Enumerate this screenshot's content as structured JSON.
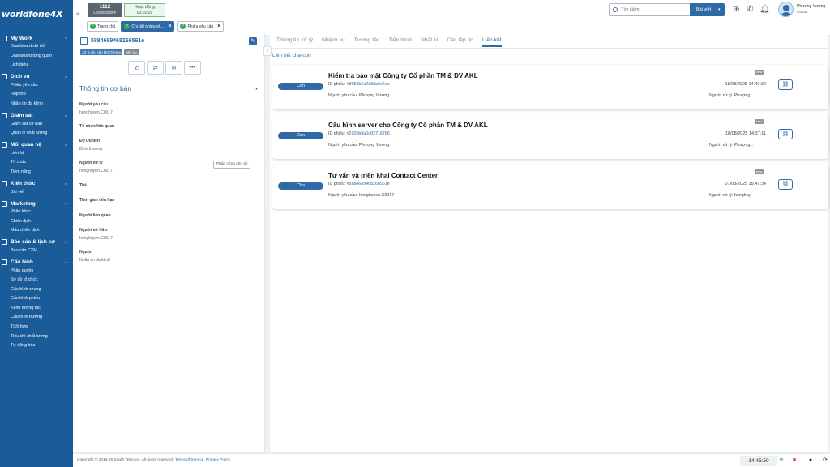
{
  "brand": {
    "logo_text": "worldfone4X",
    "accent": "#1a5c99",
    "primary": "#2f6aa7"
  },
  "sidebar": {
    "sections": [
      {
        "label": "My Work",
        "icon": "briefcase-icon",
        "items": [
          "Dashboard chi tiết",
          "Dashboard tổng quan",
          "Lịch biểu"
        ]
      },
      {
        "label": "Dịch vụ",
        "icon": "headset-icon",
        "items": [
          "Phiếu yêu cầu",
          "Hộp thư",
          "Nhắn tin đa kênh"
        ]
      },
      {
        "label": "Giám sát",
        "icon": "monitor-icon",
        "items": [
          "Giám sát cơ bản",
          "Quản lý chất lượng"
        ]
      },
      {
        "label": "Mối quan hệ",
        "icon": "users-icon",
        "items": [
          "Liên hệ",
          "Tổ chức",
          "Tiềm năng"
        ]
      },
      {
        "label": "Kiến thức",
        "icon": "book-icon",
        "items": [
          "Bài viết"
        ]
      },
      {
        "label": "Marketing",
        "icon": "megaphone-icon",
        "items": [
          "Phân khúc",
          "Chiến dịch",
          "Mẫu chiến dịch"
        ]
      },
      {
        "label": "Báo cáo & lịch sử",
        "icon": "chart-icon",
        "items": [
          "Báo cáo CXM"
        ]
      },
      {
        "label": "Cấu hình",
        "icon": "gear-icon",
        "items": [
          "Phân quyền",
          "Sơ đồ tổ chức",
          "Cấu hình chung",
          "Cấu hình phiếu",
          "Kênh tương tác",
          "Cấu hình trường",
          "Tích hợp",
          "Tiêu chí chất lượng",
          "Tự động hóa"
        ]
      }
    ]
  },
  "topbar": {
    "extension": {
      "number": "1112",
      "status": "LOGGEDOFF"
    },
    "activity": {
      "label": "Hoạt động",
      "timer": "00:02:26"
    },
    "tabs": [
      {
        "label": "Trang chủ",
        "closable": false,
        "active": false
      },
      {
        "label": "Chi tiết phiếu yê...",
        "closable": true,
        "active": true
      },
      {
        "label": "Phiếu yêu cầu",
        "closable": true,
        "active": false
      }
    ],
    "search": {
      "placeholder": "Tìm kiếm",
      "scope": "Bài viết"
    },
    "user": {
      "name": "Phượng Vương",
      "id": "C0017"
    }
  },
  "ticket": {
    "id": "5884689468266561e",
    "tags": [
      "Xử lý yêu cầu khách hàng",
      "Mới tạo"
    ],
    "info_title": "Thông tin cơ bản",
    "fields": [
      {
        "label": "Người yêu cầu",
        "value": "honghuyen.C0017"
      },
      {
        "label": "Tổ chức liên quan",
        "value": ""
      },
      {
        "label": "Độ ưu tiên",
        "value": "Bình thường"
      },
      {
        "label": "Người xử lý",
        "value": "honghuyen.C0017"
      },
      {
        "label": "Thẻ",
        "value": ""
      },
      {
        "label": "Thời gian đến hạn",
        "value": ""
      },
      {
        "label": "Người liên quan",
        "value": ""
      },
      {
        "label": "Người sở hữu",
        "value": "honghuyen.C0017"
      },
      {
        "label": "Nguồn",
        "value": "Nhắn tin đa kênh"
      }
    ],
    "assign_label": "Phân công cho tôi"
  },
  "right": {
    "tabs": [
      "Thông tin xử lý",
      "Nhiệm vụ",
      "Tương tác",
      "Tiến trình",
      "Nhật kí",
      "Các tệp tin",
      "Liên kết"
    ],
    "active_tab": "Liên kết",
    "section_title": "Liên kết cha-con",
    "links": [
      {
        "relation": "Con",
        "title": "Kiểm tra bảo mật Công ty Cổ phần TM & DV AKL",
        "id_label": "ID phiếu:",
        "id": "#8058b6a2d8da6e4ee",
        "status": "new",
        "date": "18/08/2025 14:40:30",
        "requester": "Người yêu cầu: Phượng Vương",
        "handler": "Người xử lý: Phượng..."
      },
      {
        "relation": "Con",
        "title": "Cấu hình server cho Công ty Cổ phần TM & DV AKL",
        "id_label": "ID phiếu:",
        "id": "#2920b8a0d827167b6",
        "status": "new",
        "date": "18/08/2025 14:37:11",
        "requester": "Người yêu cầu: Phượng Vương",
        "handler": "Người xử lý: Phượng..."
      },
      {
        "relation": "Cha",
        "title": "Tư vấn và triển khai Contact Center",
        "id_label": "ID phiếu:",
        "id": "#5884689468266561e",
        "status": "new",
        "date": "07/08/2025 15:47:34",
        "requester": "Người yêu cầu: honghuyen.C0017",
        "handler": "Người xử lý: honghuy"
      }
    ]
  },
  "footer": {
    "copyright": "Copyright © 2016-25 South Telecom. All rights reserved.",
    "terms": "Terms of Service.",
    "privacy": "Privacy Policy.",
    "clock": "14:45:50"
  }
}
